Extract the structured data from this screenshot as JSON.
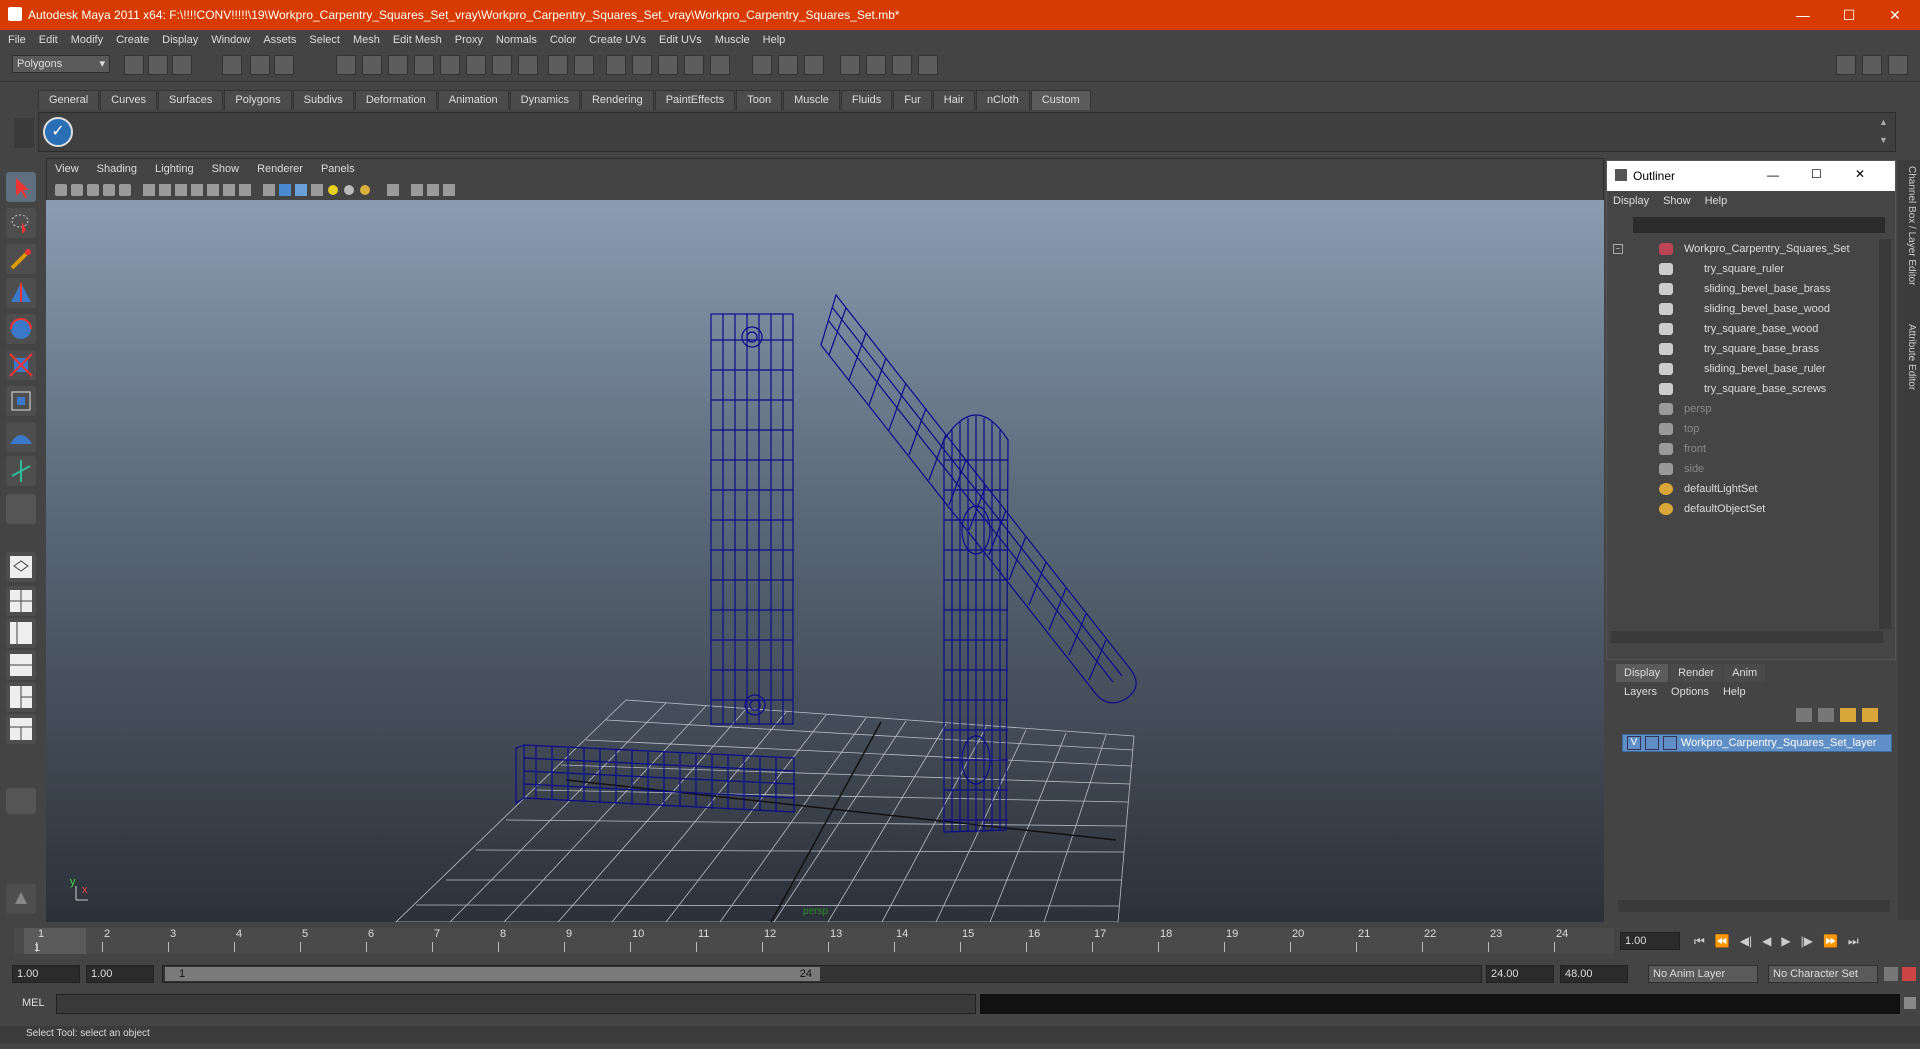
{
  "window": {
    "title": "Autodesk Maya 2011 x64: F:\\!!!!CONV!!!!!\\19\\Workpro_Carpentry_Squares_Set_vray\\Workpro_Carpentry_Squares_Set_vray\\Workpro_Carpentry_Squares_Set.mb*",
    "minimize": "—",
    "maximize": "☐",
    "close": "✕"
  },
  "menubar": [
    "File",
    "Edit",
    "Modify",
    "Create",
    "Display",
    "Window",
    "Assets",
    "Select",
    "Mesh",
    "Edit Mesh",
    "Proxy",
    "Normals",
    "Color",
    "Create UVs",
    "Edit UVs",
    "Muscle",
    "Help"
  ],
  "mode_select": "Polygons",
  "shelf_tabs": [
    "General",
    "Curves",
    "Surfaces",
    "Polygons",
    "Subdivs",
    "Deformation",
    "Animation",
    "Dynamics",
    "Rendering",
    "PaintEffects",
    "Toon",
    "Muscle",
    "Fluids",
    "Fur",
    "Hair",
    "nCloth",
    "Custom"
  ],
  "active_shelf": "Custom",
  "panel_menu": [
    "View",
    "Shading",
    "Lighting",
    "Show",
    "Renderer",
    "Panels"
  ],
  "viewport": {
    "axis_y": "y",
    "axis_x": "x",
    "camera": "persp"
  },
  "outliner": {
    "title": "Outliner",
    "menu": [
      "Display",
      "Show",
      "Help"
    ],
    "items": [
      {
        "label": "Workpro_Carpentry_Squares_Set",
        "dim": false
      },
      {
        "label": "try_square_ruler",
        "dim": false
      },
      {
        "label": "sliding_bevel_base_brass",
        "dim": false
      },
      {
        "label": "sliding_bevel_base_wood",
        "dim": false
      },
      {
        "label": "try_square_base_wood",
        "dim": false
      },
      {
        "label": "try_square_base_brass",
        "dim": false
      },
      {
        "label": "sliding_bevel_base_ruler",
        "dim": false
      },
      {
        "label": "try_square_base_screws",
        "dim": false
      },
      {
        "label": "persp",
        "dim": true
      },
      {
        "label": "top",
        "dim": true
      },
      {
        "label": "front",
        "dim": true
      },
      {
        "label": "side",
        "dim": true
      },
      {
        "label": "defaultLightSet",
        "dim": false
      },
      {
        "label": "defaultObjectSet",
        "dim": false
      }
    ]
  },
  "layer_editor": {
    "tabs": [
      "Display",
      "Render",
      "Anim"
    ],
    "menu": [
      "Layers",
      "Options",
      "Help"
    ],
    "layer_name": "Workpro_Carpentry_Squares_Set_layer",
    "visible_flag": "V"
  },
  "side_tabs": [
    "Channel Box / Layer Editor",
    "Attribute Editor"
  ],
  "timeline": {
    "ticks": [
      "1",
      "2",
      "3",
      "4",
      "5",
      "6",
      "7",
      "8",
      "9",
      "10",
      "11",
      "12",
      "13",
      "14",
      "15",
      "16",
      "17",
      "18",
      "19",
      "20",
      "21",
      "22",
      "23",
      "24"
    ],
    "current_frame": "1",
    "current_time": "1.00"
  },
  "range": {
    "start": "1.00",
    "playback_start": "1.00",
    "range_start": "1",
    "range_end": "24",
    "playback_end": "24.00",
    "end": "48.00",
    "anim_layer": "No Anim Layer",
    "character_set": "No Character Set"
  },
  "cmdline": {
    "label": "MEL"
  },
  "helpline": "Select Tool: select an object",
  "colors": {
    "title_bar": "#d83b01",
    "wireframe": "#0b0b8a",
    "viewport_top": "#8a9db3",
    "viewport_bottom": "#2c3139",
    "layer_highlight": "#5f8fc6"
  }
}
